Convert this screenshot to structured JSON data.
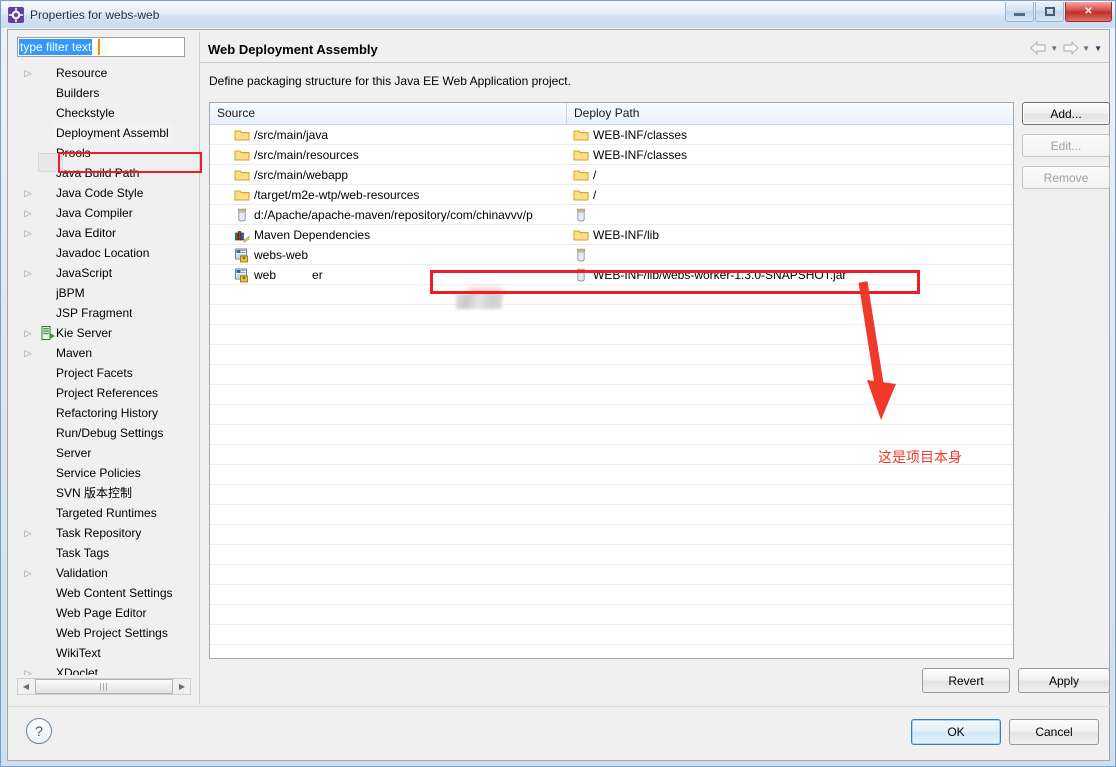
{
  "window": {
    "title": "Properties for webs-web",
    "icon": "eclipse-properties-icon",
    "minimize_label": "Minimize",
    "maximize_label": "Maximize",
    "close_label": "Close"
  },
  "filter": {
    "value": "type filter text",
    "placeholder": "type filter text"
  },
  "tree": {
    "items": [
      {
        "label": "Resource",
        "expandable": true,
        "icon": "",
        "indent": 0,
        "selected": false
      },
      {
        "label": "Builders",
        "expandable": false,
        "icon": "",
        "indent": 0,
        "selected": false
      },
      {
        "label": "Checkstyle",
        "expandable": false,
        "icon": "",
        "indent": 0,
        "selected": false
      },
      {
        "label": "Deployment Assembl",
        "expandable": false,
        "icon": "",
        "indent": 0,
        "selected": true
      },
      {
        "label": "Drools",
        "expandable": false,
        "icon": "",
        "indent": 0,
        "selected": false
      },
      {
        "label": "Java Build Path",
        "expandable": false,
        "icon": "",
        "indent": 0,
        "selected": false
      },
      {
        "label": "Java Code Style",
        "expandable": true,
        "icon": "",
        "indent": 0,
        "selected": false
      },
      {
        "label": "Java Compiler",
        "expandable": true,
        "icon": "",
        "indent": 0,
        "selected": false
      },
      {
        "label": "Java Editor",
        "expandable": true,
        "icon": "",
        "indent": 0,
        "selected": false
      },
      {
        "label": "Javadoc Location",
        "expandable": false,
        "icon": "",
        "indent": 0,
        "selected": false
      },
      {
        "label": "JavaScript",
        "expandable": true,
        "icon": "",
        "indent": 0,
        "selected": false
      },
      {
        "label": "jBPM",
        "expandable": false,
        "icon": "",
        "indent": 0,
        "selected": false
      },
      {
        "label": "JSP Fragment",
        "expandable": false,
        "icon": "",
        "indent": 0,
        "selected": false
      },
      {
        "label": "Kie Server",
        "expandable": true,
        "icon": "kie-server-icon",
        "indent": 0,
        "selected": false
      },
      {
        "label": "Maven",
        "expandable": true,
        "icon": "",
        "indent": 0,
        "selected": false
      },
      {
        "label": "Project Facets",
        "expandable": false,
        "icon": "",
        "indent": 0,
        "selected": false
      },
      {
        "label": "Project References",
        "expandable": false,
        "icon": "",
        "indent": 0,
        "selected": false
      },
      {
        "label": "Refactoring History",
        "expandable": false,
        "icon": "",
        "indent": 0,
        "selected": false
      },
      {
        "label": "Run/Debug Settings",
        "expandable": false,
        "icon": "",
        "indent": 0,
        "selected": false
      },
      {
        "label": "Server",
        "expandable": false,
        "icon": "",
        "indent": 0,
        "selected": false
      },
      {
        "label": "Service Policies",
        "expandable": false,
        "icon": "",
        "indent": 0,
        "selected": false
      },
      {
        "label": "SVN 版本控制",
        "expandable": false,
        "icon": "",
        "indent": 0,
        "selected": false
      },
      {
        "label": "Targeted Runtimes",
        "expandable": false,
        "icon": "",
        "indent": 0,
        "selected": false
      },
      {
        "label": "Task Repository",
        "expandable": true,
        "icon": "",
        "indent": 0,
        "selected": false
      },
      {
        "label": "Task Tags",
        "expandable": false,
        "icon": "",
        "indent": 0,
        "selected": false
      },
      {
        "label": "Validation",
        "expandable": true,
        "icon": "",
        "indent": 0,
        "selected": false
      },
      {
        "label": "Web Content Settings",
        "expandable": false,
        "icon": "",
        "indent": 0,
        "selected": false
      },
      {
        "label": "Web Page Editor",
        "expandable": false,
        "icon": "",
        "indent": 0,
        "selected": false
      },
      {
        "label": "Web Project Settings",
        "expandable": false,
        "icon": "",
        "indent": 0,
        "selected": false
      },
      {
        "label": "WikiText",
        "expandable": false,
        "icon": "",
        "indent": 0,
        "selected": false
      },
      {
        "label": "XDoclet",
        "expandable": true,
        "icon": "",
        "indent": 0,
        "selected": false
      }
    ]
  },
  "page": {
    "title": "Web Deployment Assembly",
    "description": "Define packaging structure for this Java EE Web Application project."
  },
  "nav": {
    "back_icon": "arrow-left-icon",
    "back_menu_icon": "chevron-down-icon",
    "forward_icon": "arrow-right-icon",
    "forward_menu_icon": "chevron-down-icon",
    "view_menu_icon": "chevron-down-filled-icon"
  },
  "table": {
    "columns": [
      "Source",
      "Deploy Path"
    ],
    "sort_column": "Source",
    "sort_direction": "ascending",
    "rows": [
      {
        "source": "/src/main/java",
        "source_icon": "folder-icon",
        "deploy": "WEB-INF/classes",
        "deploy_icon": "folder-icon",
        "highlighted": false
      },
      {
        "source": "/src/main/resources",
        "source_icon": "folder-icon",
        "deploy": "WEB-INF/classes",
        "deploy_icon": "folder-icon",
        "highlighted": false
      },
      {
        "source": "/src/main/webapp",
        "source_icon": "folder-icon",
        "deploy": "/",
        "deploy_icon": "folder-icon",
        "highlighted": false
      },
      {
        "source": "/target/m2e-wtp/web-resources",
        "source_icon": "folder-icon",
        "deploy": "/",
        "deploy_icon": "folder-icon",
        "highlighted": false
      },
      {
        "source": "d:/Apache/apache-maven/repository/com/chinavvv/p",
        "source_icon": "jar-icon",
        "deploy": "",
        "deploy_icon": "jar-icon",
        "highlighted": false
      },
      {
        "source": "Maven Dependencies",
        "source_icon": "library-icon",
        "deploy": "WEB-INF/lib",
        "deploy_icon": "folder-icon",
        "highlighted": false
      },
      {
        "source": "webs-web",
        "source_icon": "project-icon",
        "deploy": "",
        "deploy_icon": "jar-icon",
        "highlighted": true
      },
      {
        "source": "web   er",
        "source_icon": "project-icon",
        "deploy": "WEB-INF/lib/webs-worker-1.3.0-SNAPSHOT.jar",
        "deploy_icon": "jar-icon",
        "highlighted": false
      }
    ],
    "empty_row_count": 19
  },
  "buttons": {
    "add": "Add...",
    "edit": "Edit...",
    "remove": "Remove",
    "revert": "Revert",
    "apply": "Apply",
    "ok": "OK",
    "cancel": "Cancel",
    "help_icon": "question-mark-icon",
    "add_enabled": true,
    "edit_enabled": false,
    "remove_enabled": false
  },
  "annotations": {
    "note_text": "这是项目本身",
    "note_color": "#f0392b",
    "box_color": "#ee1c24",
    "arrow_icon": "red-arrow-down-icon"
  }
}
